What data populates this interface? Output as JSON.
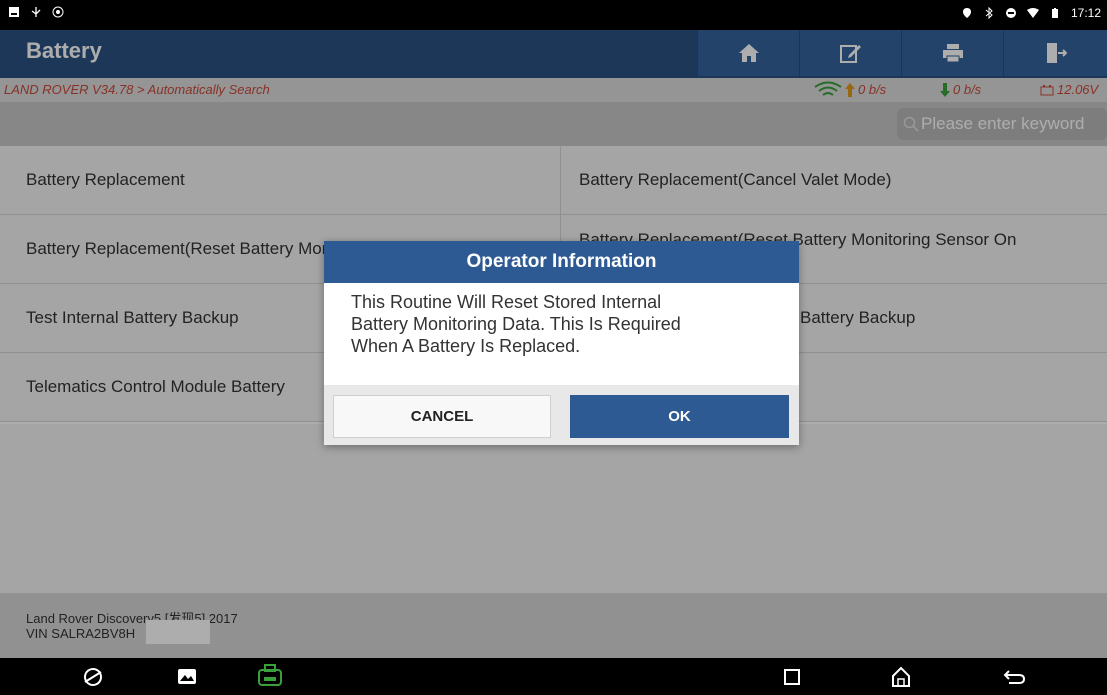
{
  "statusbar": {
    "time": "17:12",
    "left_icons": [
      "notification-icon",
      "usb-icon",
      "debug-icon"
    ],
    "right_icons": [
      "location-icon",
      "bluetooth-icon",
      "dnd-icon",
      "wifi-icon",
      "battery-icon"
    ]
  },
  "header": {
    "title": "Battery",
    "buttons": [
      {
        "name": "home-icon"
      },
      {
        "name": "edit-icon"
      },
      {
        "name": "print-icon"
      },
      {
        "name": "exit-icon"
      }
    ]
  },
  "crumb": {
    "path": "LAND ROVER V34.78 > Automatically Search",
    "upload": "0 b/s",
    "download": "0 b/s",
    "voltage": "12.06V"
  },
  "search": {
    "placeholder": "Please enter keyword"
  },
  "functions": [
    "Battery Replacement",
    "Battery Replacement(Cancel Valet Mode)",
    "Battery Replacement(Reset Battery Monitoring Sensor On Battery #1)",
    "Battery Replacement(Reset Battery Monitoring Sensor On",
    "Test Internal Battery Backup",
    "Battery Backup",
    "Telematics Control Module Battery",
    ""
  ],
  "footer": {
    "vehicle": "Land Rover Discovery5 [发现5] 2017",
    "vin": "VIN SALRA2BV8H"
  },
  "dialog": {
    "title": "Operator Information",
    "message_lines": [
      "This Routine Will Reset Stored Internal",
      "Battery Monitoring Data. This Is Required",
      "When A Battery Is Replaced."
    ],
    "cancel_label": "CANCEL",
    "ok_label": "OK"
  },
  "colors": {
    "header": "#2a5182",
    "accent_red": "#c94a3a",
    "dialog_head": "#2e5a94",
    "vci_green": "#3aa03a"
  }
}
